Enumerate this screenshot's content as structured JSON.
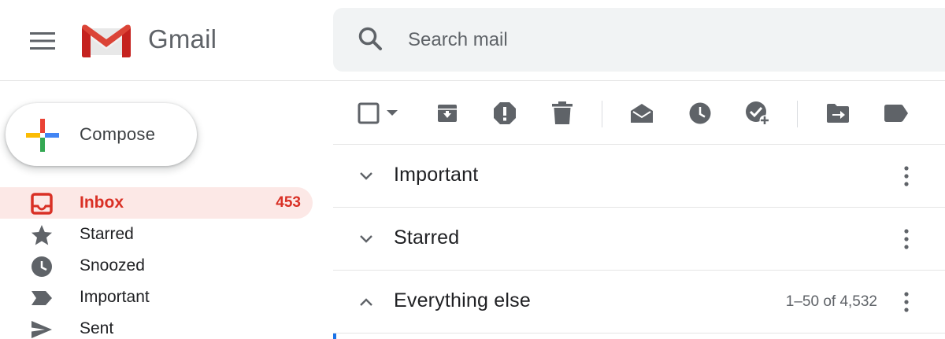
{
  "app": {
    "name": "Gmail"
  },
  "search": {
    "placeholder": "Search mail"
  },
  "compose": {
    "label": "Compose"
  },
  "sidebar": {
    "items": [
      {
        "label": "Inbox",
        "count": "453",
        "icon": "inbox-icon",
        "active": true
      },
      {
        "label": "Starred",
        "icon": "star-icon"
      },
      {
        "label": "Snoozed",
        "icon": "clock-icon"
      },
      {
        "label": "Important",
        "icon": "important-icon"
      },
      {
        "label": "Sent",
        "icon": "send-icon"
      }
    ]
  },
  "toolbar": {
    "icons": [
      "select-checkbox",
      "select-dropdown",
      "archive-icon",
      "report-spam-icon",
      "delete-icon",
      "mark-read-icon",
      "snooze-icon",
      "add-task-icon",
      "move-to-icon",
      "label-icon"
    ]
  },
  "sections": [
    {
      "title": "Important",
      "expanded": false
    },
    {
      "title": "Starred",
      "expanded": false
    },
    {
      "title": "Everything else",
      "expanded": true,
      "range": "1–50 of 4,532"
    }
  ],
  "colors": {
    "accent_red": "#d93025",
    "active_bg": "#fce8e6",
    "icon_gray": "#5f6368",
    "search_bg": "#f1f3f4"
  }
}
